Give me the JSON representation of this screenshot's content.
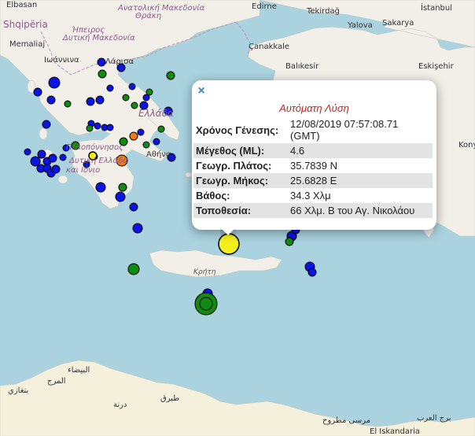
{
  "map_labels": {
    "elbasan": "Elbasan",
    "shqiperia": "Shqipëria",
    "memaliaj": "Memaliaj",
    "ioannina": "Ιωάννινα",
    "ipeiros": "Ήπειρος",
    "dytiki_makedonia": "Δυτική Μακεδονία",
    "anatoliki_makedonia": "Ανατολική Μακεδονία",
    "thraki": "Θράκη",
    "edirne": "Edirne",
    "tekirdag": "Tekirdağ",
    "istanbul": "İstanbul",
    "yalova": "Yalova",
    "sakarya": "Sakarya",
    "canakkale": "Çanakkale",
    "balikesir": "Balıkesir",
    "eskisehir": "Eskişehir",
    "larisa": "Λάρισα",
    "ellada": "Ελλάδα",
    "athina": "Αθήνα",
    "peloponnisos": "Πελοπόννησος",
    "dytiki_ellada": "Δυτική Ελλάδα",
    "kai_ionio": "και Ιόνιο",
    "kriti": "Κρήτη",
    "libya_city1": "بنغازي",
    "libya_city2": "المرج",
    "libya_city3": "البيضاء",
    "libya_city4": "درنة",
    "libya_city5": "طبرق",
    "egypt_city1": "مرسى مطروح",
    "egypt_city2": "برج العرب",
    "alexandria": "El Iskandaria",
    "konya": "Konya"
  },
  "popup": {
    "title": "Αυτόματη Λύση",
    "close_symbol": "×",
    "rows": [
      {
        "key": "Χρόνος Γένεσης:",
        "value": "12/08/2019 07:57:08.71 (GMT)"
      },
      {
        "key": "Μέγεθος (ML):",
        "value": "4.6"
      },
      {
        "key": "Γεωγρ. Πλάτος:",
        "value": "35.7839 N"
      },
      {
        "key": "Γεωγρ. Μήκος:",
        "value": "25.6828 E"
      },
      {
        "key": "Βάθος:",
        "value": "34.3 Χλμ"
      },
      {
        "key": "Τοποθεσία:",
        "value": "66 Χλμ. Β του Αγ. Νικολάου"
      }
    ]
  },
  "marker_colors": {
    "blue": "#0a14e6",
    "green": "#108a10",
    "orange": "#f07a14",
    "yellow": "#f4ef1a",
    "selected_yellow": "#f4f01e"
  },
  "map_colors": {
    "sea": "#aad3df",
    "land": "#f2efe9",
    "desert": "#f5f0dc",
    "border": "#b89ab8"
  }
}
